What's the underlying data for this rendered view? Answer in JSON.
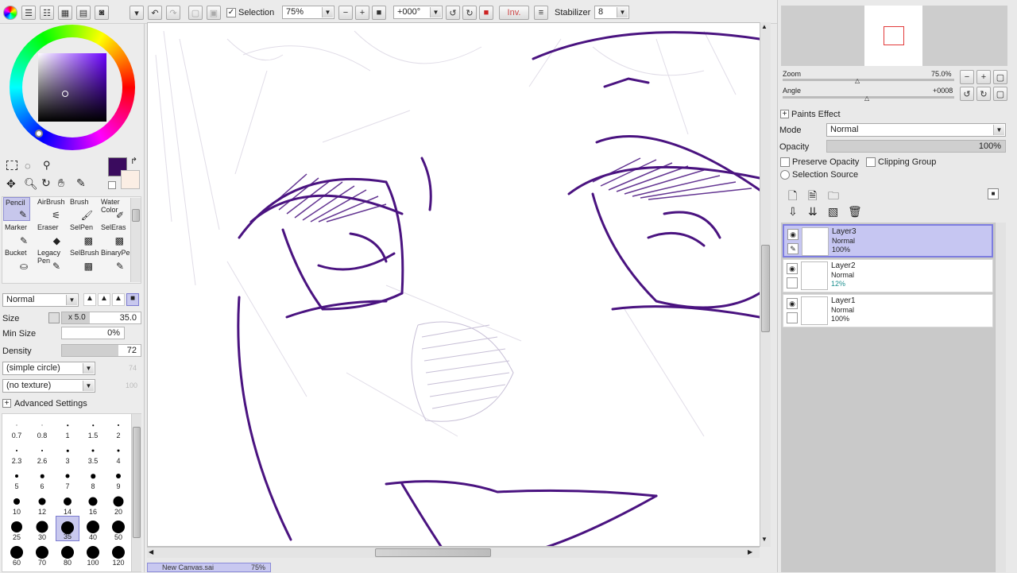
{
  "toolbar": {
    "selection_label": "Selection",
    "zoom_value": "75%",
    "angle_value": "+000°",
    "invert_label": "Inv.",
    "stabilizer_label": "Stabilizer",
    "stabilizer_value": "8"
  },
  "navigator": {
    "zoom_label": "Zoom",
    "zoom_value": "75.0%",
    "angle_label": "Angle",
    "angle_value": "+0008"
  },
  "layer_panel": {
    "paints_effect": "Paints Effect",
    "mode_label": "Mode",
    "mode_value": "Normal",
    "opacity_label": "Opacity",
    "opacity_value": "100%",
    "preserve_opacity": "Preserve Opacity",
    "clipping_group": "Clipping Group",
    "selection_source": "Selection Source",
    "layers": [
      {
        "name": "Layer3",
        "mode": "Normal",
        "opacity": "100%"
      },
      {
        "name": "Layer2",
        "mode": "Normal",
        "opacity": "12%"
      },
      {
        "name": "Layer1",
        "mode": "Normal",
        "opacity": "100%"
      }
    ]
  },
  "tools": [
    {
      "label": "Pencil"
    },
    {
      "label": "AirBrush"
    },
    {
      "label": "Brush"
    },
    {
      "label": "Water Color"
    },
    {
      "label": "Marker"
    },
    {
      "label": "Eraser"
    },
    {
      "label": "SelPen"
    },
    {
      "label": "SelEras"
    },
    {
      "label": "Bucket"
    },
    {
      "label": "Legacy Pen"
    },
    {
      "label": "SelBrush"
    },
    {
      "label": "BinaryPe"
    }
  ],
  "brush": {
    "blend_mode": "Normal",
    "size_label": "Size",
    "size_mult": "x 5.0",
    "size_value": "35.0",
    "min_size_label": "Min Size",
    "min_size_value": "0%",
    "density_label": "Density",
    "density_value": "72",
    "shape": "(simple circle)",
    "shape_value": "74",
    "texture": "(no texture)",
    "texture_value": "100",
    "advanced_settings": "Advanced Settings",
    "presets": [
      "0.7",
      "0.8",
      "1",
      "1.5",
      "2",
      "2.3",
      "2.6",
      "3",
      "3.5",
      "4",
      "5",
      "6",
      "7",
      "8",
      "9",
      "10",
      "12",
      "14",
      "16",
      "20",
      "25",
      "30",
      "35",
      "40",
      "50",
      "60",
      "70",
      "80",
      "100",
      "120"
    ]
  },
  "statusbar": {
    "tab_label": "New Canvas.sai",
    "tab_zoom": "75%"
  },
  "colors": {
    "primary": "#3a0b5e",
    "secondary": "#fbeee4",
    "accent": "#7b7bd0",
    "sketch": "#4a1380"
  }
}
